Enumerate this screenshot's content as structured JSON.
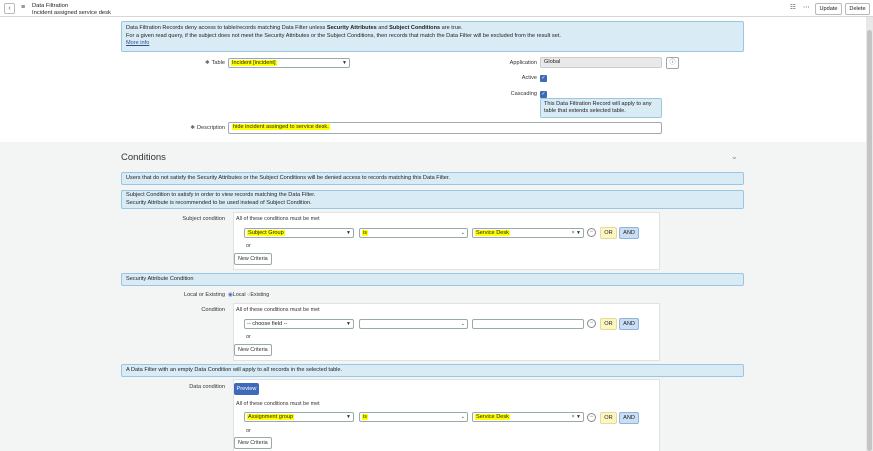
{
  "header": {
    "title": "Data Filtration",
    "subtitle": "Incident assigned service desk",
    "update_label": "Update",
    "delete_label": "Delete"
  },
  "form": {
    "info_line1_a": "Data Filtration Records deny access to table/records matching Data Filter unless ",
    "info_line1_b": "Security Attributes",
    "info_line1_c": " and ",
    "info_line1_d": "Subject Conditions",
    "info_line1_e": " are true.",
    "info_line2": "For a given read query, if the subject does not meet the Security Attributes or the Subject Conditions, then records that match the Data Filter will be excluded from the result set.",
    "more_info": "More info",
    "table_label": "Table",
    "table_value": "Incident [incident]",
    "application_label": "Application",
    "application_value": "Global",
    "active_label": "Active",
    "cascading_label": "Cascading",
    "cascading_hint": "This Data Filtration Record will apply to any table that extends selected table.",
    "description_label": "Description",
    "description_value": "hide incident assinged to service desk."
  },
  "conditions": {
    "title": "Conditions",
    "info1": "Users that do not satisfy the Security Attributes or the Subject Conditions will be denied access to records matching this Data Filter.",
    "info2_line1": "Subject Condition to satisfy in order to view records matching the Data Filter.",
    "info2_line2": "Security Attribute is recommended to be used instead of Subject Condition.",
    "subject_label": "Subject condition",
    "all_met": "All of these conditions must be met",
    "subject_field": "Subject Group",
    "subject_op": "is",
    "subject_value": "Service Desk",
    "or_label": "OR",
    "and_label": "AND",
    "or_text": "or",
    "new_criteria": "New Criteria",
    "sec_attr_bar": "Security Attribute Condition",
    "local_label": "Local or Existing",
    "local_opt": "Local",
    "existing_opt": "Existing",
    "condition_label": "Condition",
    "choose_field": "-- choose field --",
    "empty_bar": "A Data Filter with an empty Data Condition will apply to all records in the selected table.",
    "data_cond_label": "Data condition",
    "preview_label": "Preview",
    "data_field": "Assignment group",
    "data_op": "is",
    "data_value": "Service Desk"
  },
  "colors": {
    "accent": "#3e6ab9",
    "highlight": "#ffff00",
    "info_bg": "#d9ebf5"
  }
}
